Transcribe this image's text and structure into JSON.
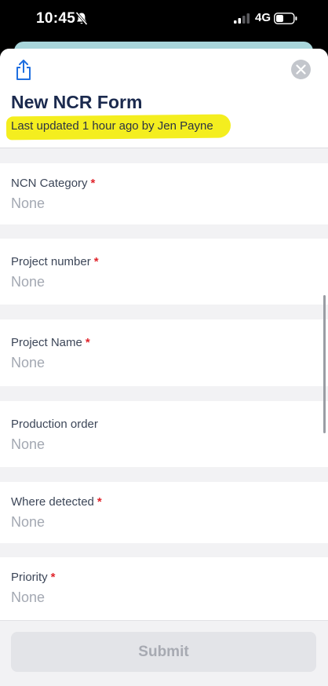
{
  "status_bar": {
    "time": "10:45",
    "network": "4G"
  },
  "header": {
    "title": "New NCR Form",
    "last_updated": "Last updated 1 hour ago by Jen Payne"
  },
  "fields": [
    {
      "label": "NCN Category",
      "required_mark": "*",
      "value": "None"
    },
    {
      "label": "Project number",
      "required_mark": "*",
      "value": "None"
    },
    {
      "label": "Project Name",
      "required_mark": "*",
      "value": "None"
    },
    {
      "label": "Production order",
      "value": "None"
    },
    {
      "label": "Where detected",
      "required_mark": "*",
      "value": "None"
    },
    {
      "label": "Priority",
      "required_mark": "*",
      "value": "None"
    }
  ],
  "footer": {
    "submit_label": "Submit"
  },
  "colors": {
    "title": "#1b2a4e",
    "highlight": "#f4ee1f",
    "required": "#e0242b",
    "accent": "#1f6fe0"
  },
  "icons": [
    "bell-slash-icon",
    "signal-icon",
    "battery-icon",
    "share-icon",
    "close-icon"
  ]
}
